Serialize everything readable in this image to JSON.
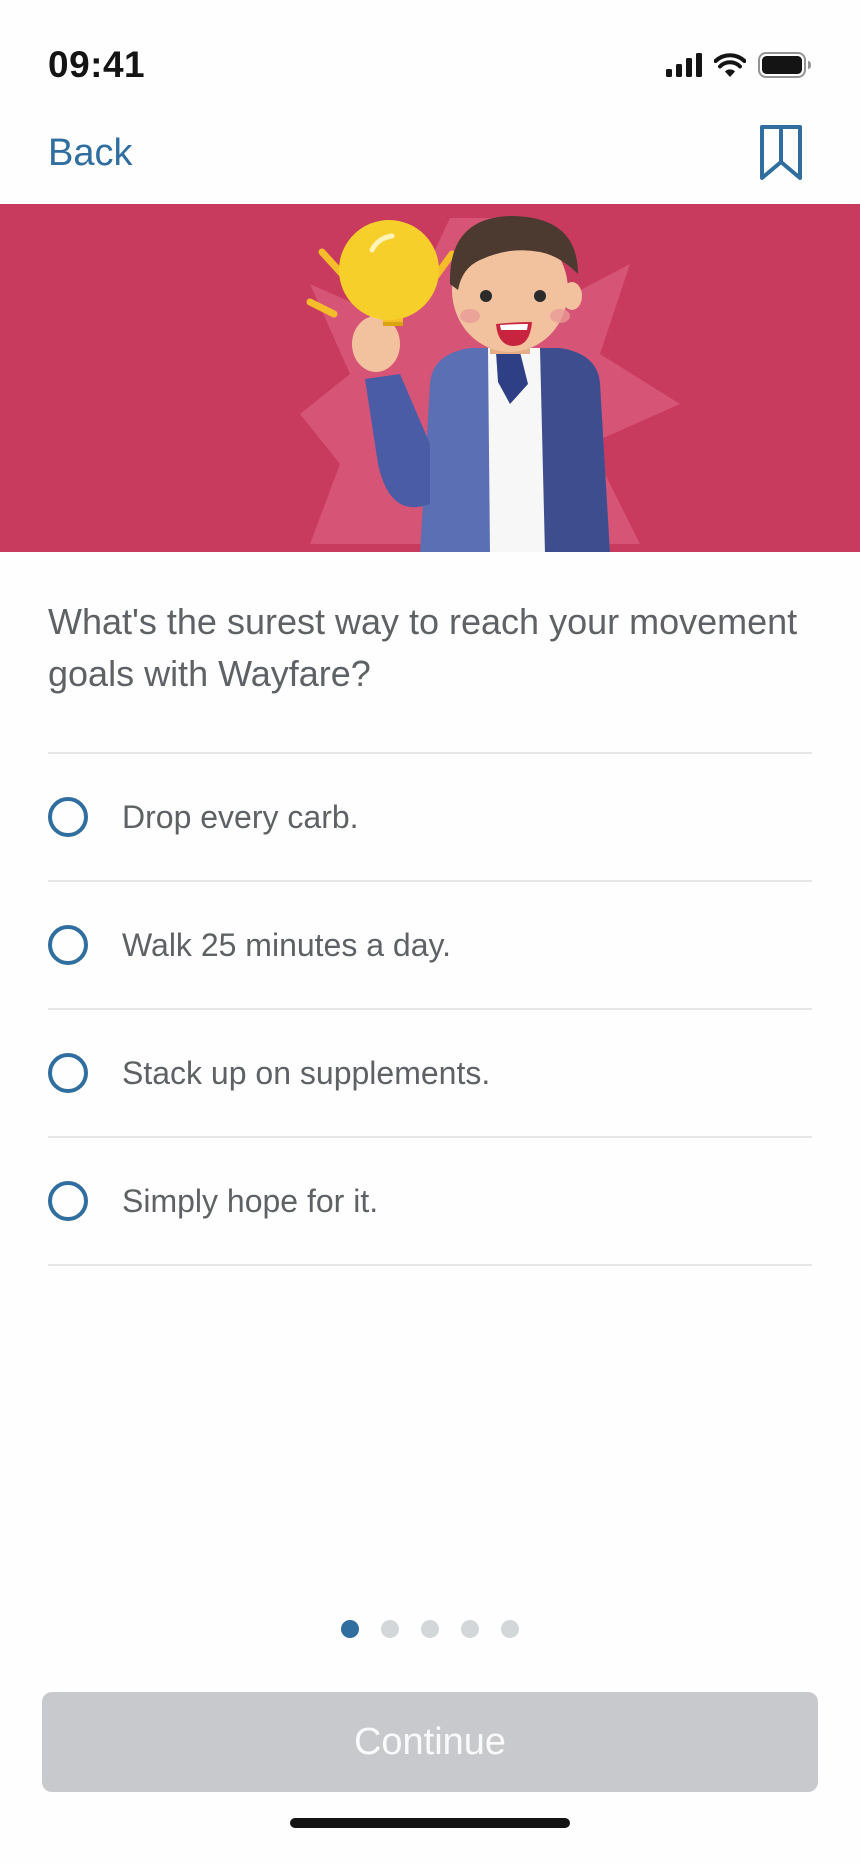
{
  "status_bar": {
    "time": "09:41",
    "icons": [
      "cellular-signal-icon",
      "wifi-icon",
      "battery-icon"
    ]
  },
  "nav": {
    "back_label": "Back",
    "bookmark_icon": "bookmark-icon"
  },
  "hero": {
    "illustration": "person-with-lightbulb-illustration",
    "background_color": "#c83a5e"
  },
  "question": {
    "text": "What's the surest way to reach your movement goals with Wayfare?"
  },
  "options": [
    {
      "label": "Drop every carb."
    },
    {
      "label": "Walk 25 minutes a day."
    },
    {
      "label": "Stack up on supplements."
    },
    {
      "label": "Simply hope for it."
    }
  ],
  "pagination": {
    "total": 5,
    "current": 1
  },
  "continue": {
    "label": "Continue",
    "enabled": false
  },
  "colors": {
    "accent": "#2f6e9f",
    "disabled_button": "#c7c9cc"
  }
}
